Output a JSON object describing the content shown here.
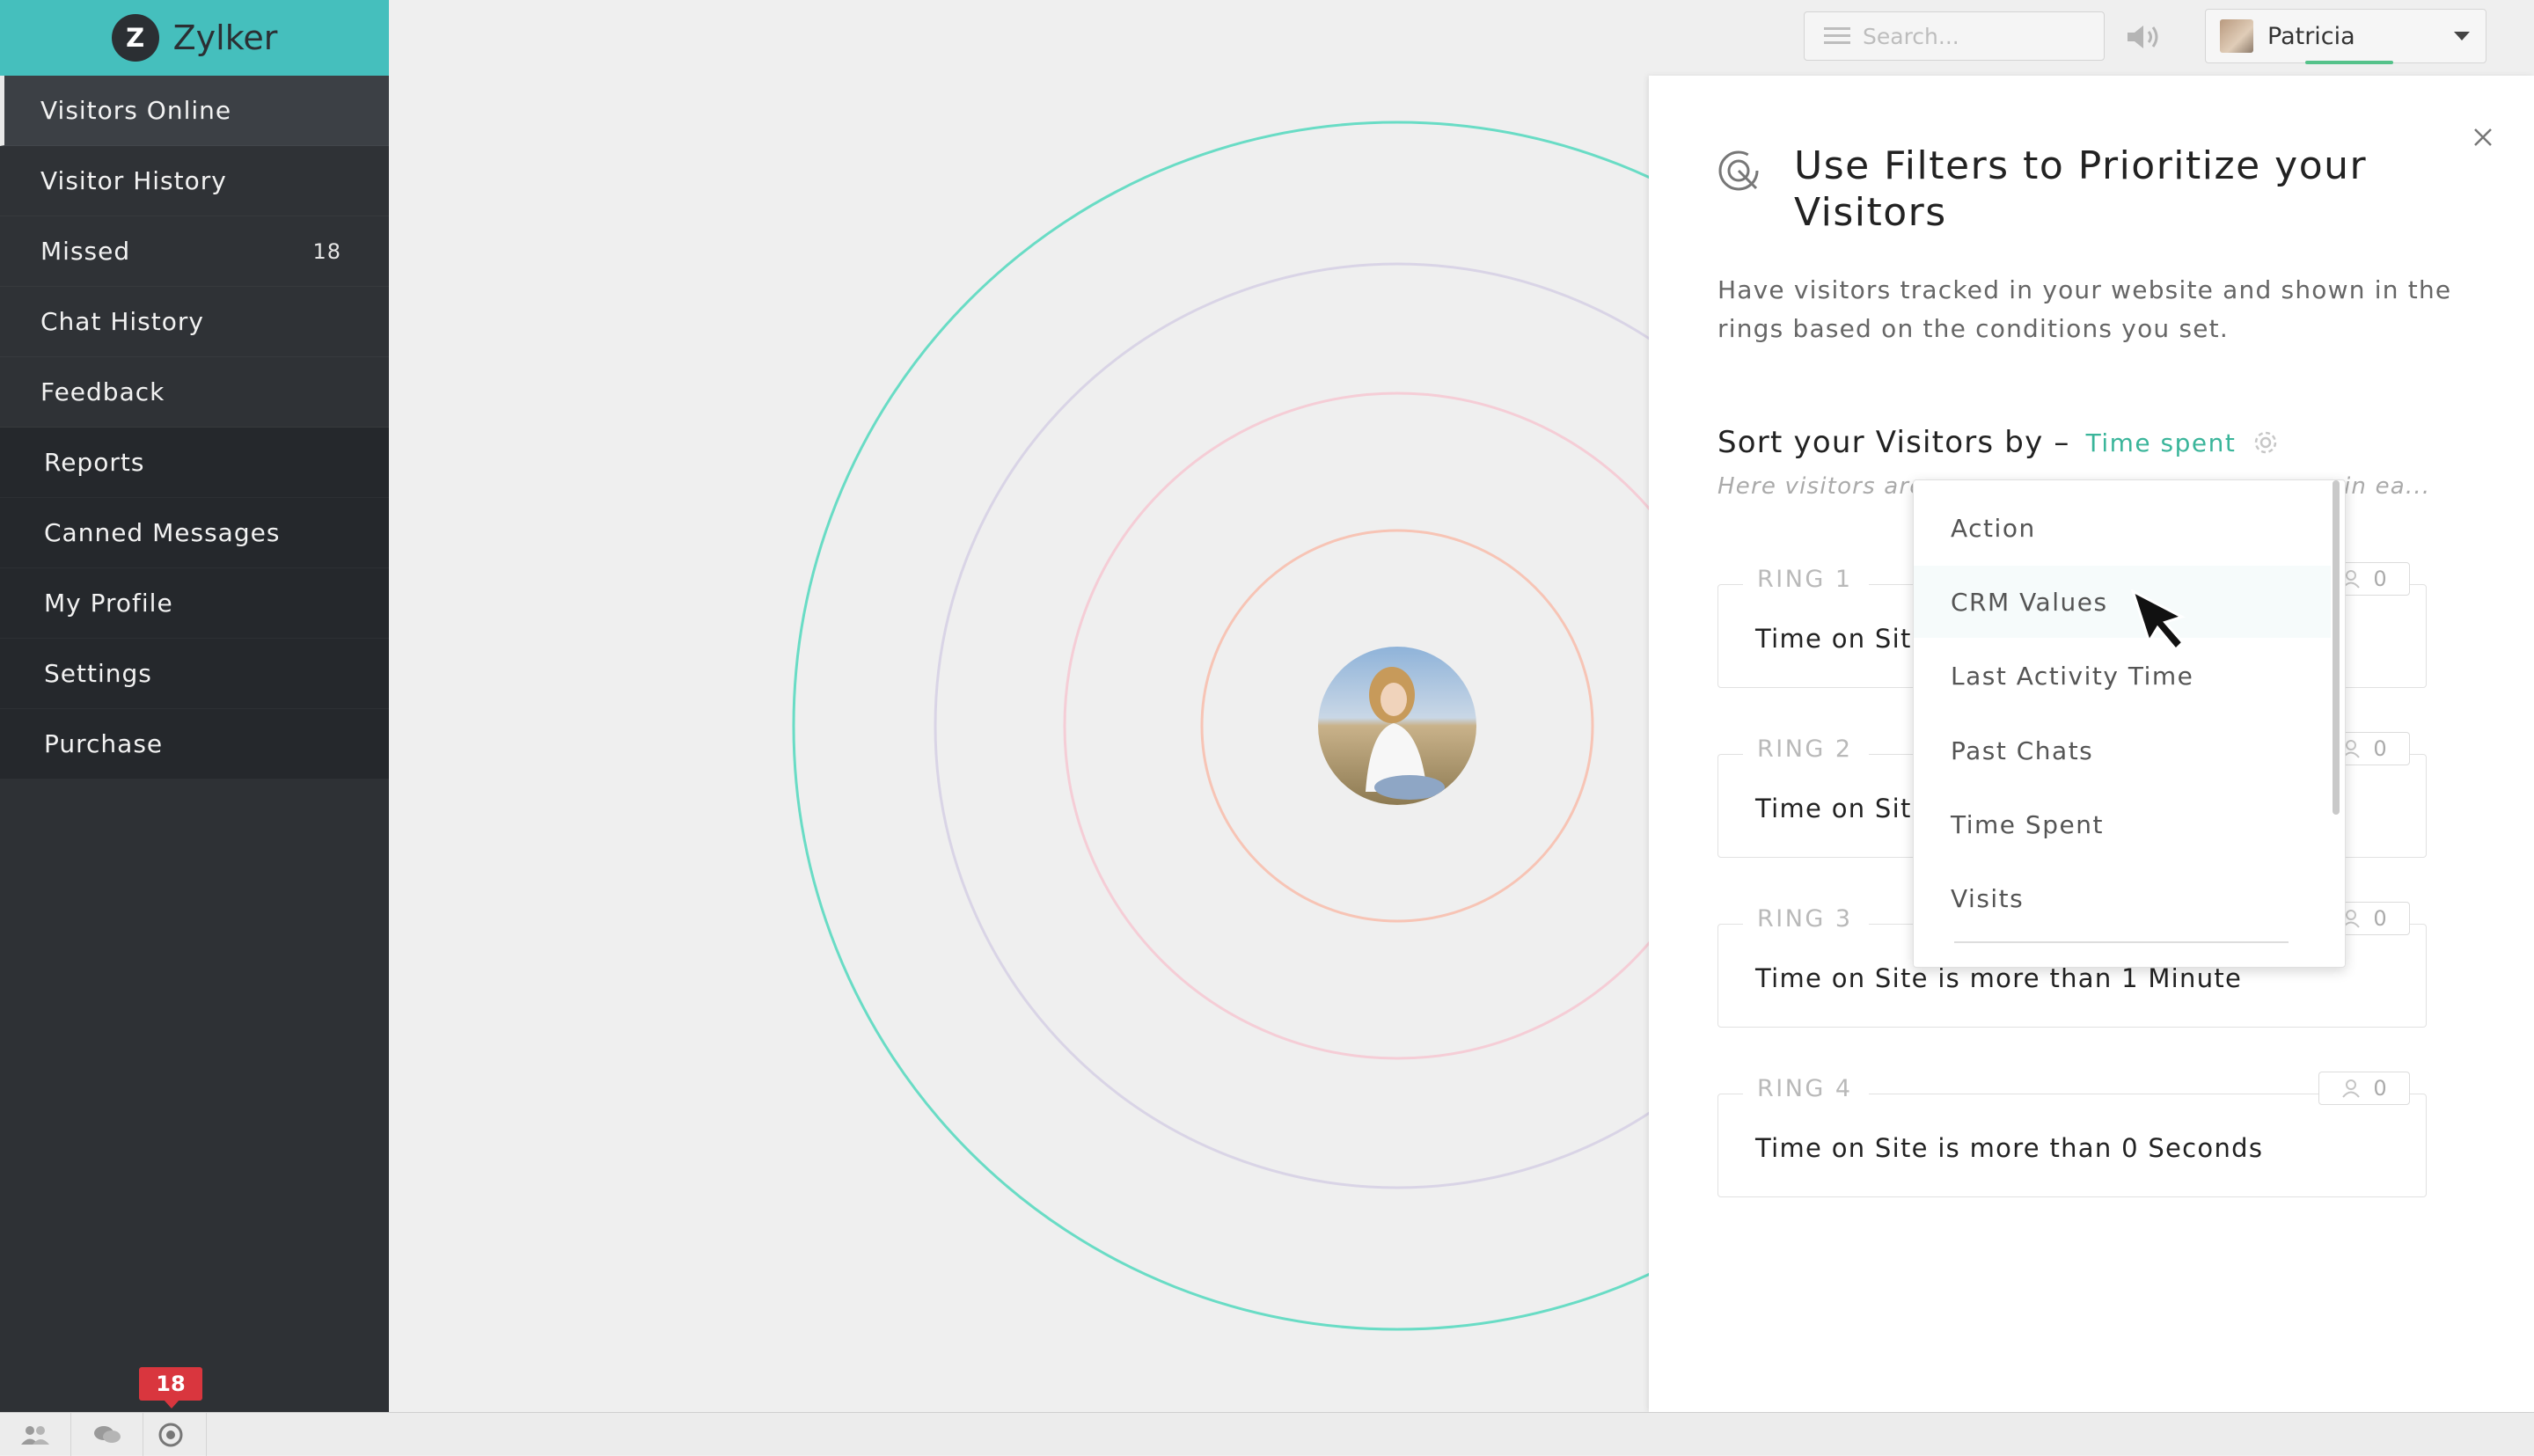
{
  "brand": {
    "logo_letter": "Z",
    "name": "Zylker"
  },
  "sidebar": {
    "items": [
      {
        "label": "Visitors Online",
        "badge": ""
      },
      {
        "label": "Visitor History",
        "badge": ""
      },
      {
        "label": "Missed",
        "badge": "18"
      },
      {
        "label": "Chat History",
        "badge": ""
      },
      {
        "label": "Feedback",
        "badge": ""
      },
      {
        "label": "Reports",
        "badge": ""
      },
      {
        "label": "Canned Messages",
        "badge": ""
      },
      {
        "label": "My Profile",
        "badge": ""
      },
      {
        "label": "Settings",
        "badge": ""
      },
      {
        "label": "Purchase",
        "badge": ""
      }
    ]
  },
  "topbar": {
    "search_placeholder": "Search...",
    "user_name": "Patricia"
  },
  "panel": {
    "title": "Use Filters to Prioritize your Visitors",
    "description": "Have visitors tracked in your website and shown in the rings based on the conditions you set.",
    "sort_label": "Sort your Visitors by –",
    "sort_value": "Time spent",
    "hint_start": "Here visitors are",
    "hint_end": "in ea...",
    "rings": [
      {
        "label": "RING 1",
        "condition": "Time on Site",
        "count": "0"
      },
      {
        "label": "RING 2",
        "condition": "Time on Site",
        "count": "0"
      },
      {
        "label": "RING 3",
        "condition": "Time on Site is more than 1 Minute",
        "count": "0"
      },
      {
        "label": "RING 4",
        "condition": "Time on Site is more than 0 Seconds",
        "count": "0"
      }
    ]
  },
  "sort_menu": {
    "options": [
      "Action",
      "CRM Values",
      "Last Activity Time",
      "Past Chats",
      "Time Spent",
      "Visits"
    ],
    "hovered": "CRM Values"
  },
  "bottom_bar": {
    "notification_count": "18"
  },
  "colors": {
    "brand": "#45bfbd",
    "sidebar": "#2e3135",
    "accent_green": "#3ab59a",
    "ring_1": "#69dcc5",
    "ring_2": "#d9d4e6",
    "ring_3": "#f5cdd6",
    "ring_4": "#f7c4b5",
    "badge_red": "#d9363e"
  },
  "icons": {
    "bottom_bar": [
      "visitors-icon",
      "chats-icon",
      "radar-icon"
    ],
    "top": [
      "menu-lines-icon",
      "speaker-icon",
      "caret-down-icon"
    ],
    "panel": [
      "target-icon",
      "close-icon",
      "gear-icon",
      "user-icon"
    ]
  }
}
